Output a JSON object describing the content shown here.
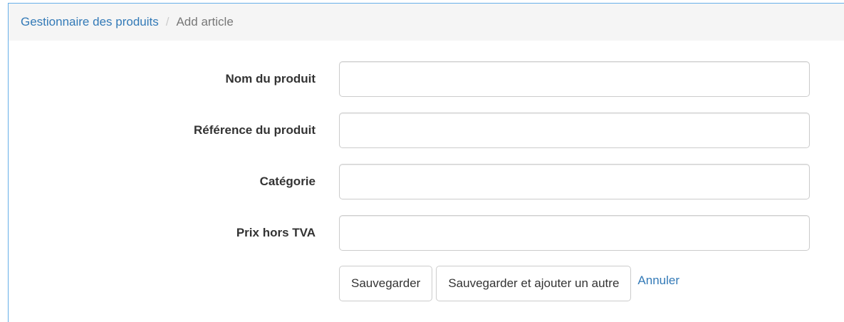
{
  "breadcrumb": {
    "root": "Gestionnaire des produits",
    "separator": "/",
    "current": "Add article"
  },
  "form": {
    "fields": [
      {
        "label": "Nom du produit",
        "value": "",
        "placeholder": ""
      },
      {
        "label": "Référence du produit",
        "value": "",
        "placeholder": ""
      },
      {
        "label": "Catégorie",
        "value": "",
        "placeholder": ""
      },
      {
        "label": "Prix hors TVA",
        "value": "",
        "placeholder": ""
      }
    ],
    "buttons": {
      "save": "Sauvegarder",
      "save_and_add": "Sauvegarder et ajouter un autre",
      "cancel": "Annuler"
    }
  },
  "colors": {
    "link": "#337ab7",
    "breadcrumb_bg": "#f5f5f5",
    "frame_border": "#66afe9",
    "input_border": "#cccccc"
  }
}
